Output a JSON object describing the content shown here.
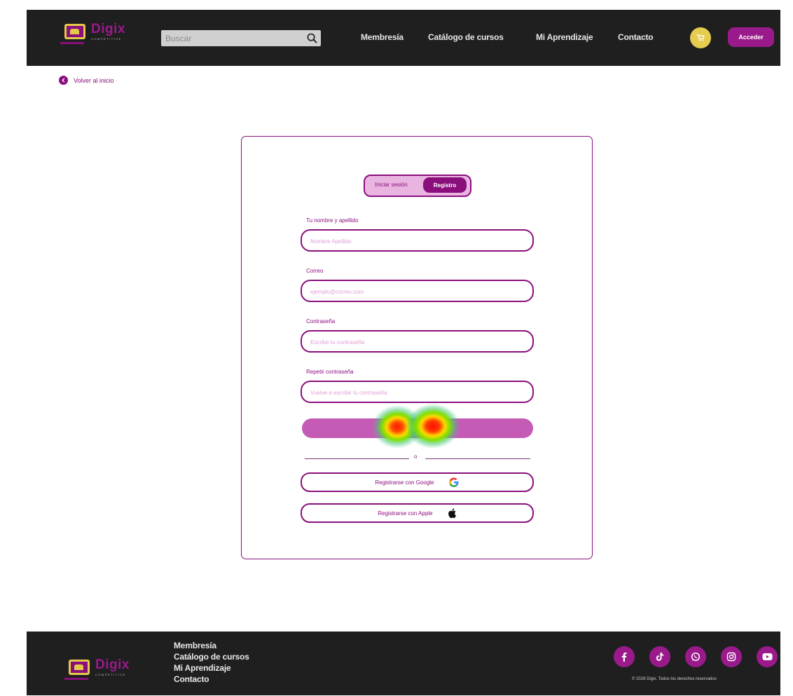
{
  "header": {
    "brand": "Digix",
    "tagline": "COMPETITIVE",
    "search_placeholder": "Buscar",
    "nav": [
      "Membresía",
      "Catálogo de cursos",
      "Mi Aprendizaje",
      "Contacto"
    ],
    "login_label": "Acceder"
  },
  "back_link": "Volver al inicio",
  "auth": {
    "tabs": {
      "login": "Iniciar sesión",
      "register": "Registro"
    },
    "fields": [
      {
        "label": "Tu nombre y apellido",
        "placeholder": "Nombre Apellido"
      },
      {
        "label": "Correo",
        "placeholder": "ejemplo@correo.com"
      },
      {
        "label": "Contraseña",
        "placeholder": "Escribe tu contraseña"
      },
      {
        "label": "Repetir contraseña",
        "placeholder": "Vuelve a escribir tu contraseña"
      }
    ],
    "divider": "o",
    "google_label": "Registrarse con Google",
    "apple_label": "Registrarse con Apple"
  },
  "footer": {
    "brand": "Digix",
    "tagline": "COMPETITIVE",
    "links": [
      "Membresía",
      "Catálogo de cursos",
      "Mi Aprendizaje",
      "Contacto"
    ],
    "copyright": "© 2026 Digix. Todos los derechos reservados"
  },
  "colors": {
    "primary": "#8a0f7d",
    "accent": "#e6cc4f",
    "dark": "#1f1f1f",
    "soft": "#e9b5e0",
    "submit": "#c55bb5"
  },
  "icons": [
    "search-icon",
    "cart-icon",
    "chevron-left-icon",
    "google-icon",
    "apple-icon",
    "facebook-icon",
    "tiktok-icon",
    "whatsapp-icon",
    "instagram-icon",
    "youtube-icon"
  ]
}
